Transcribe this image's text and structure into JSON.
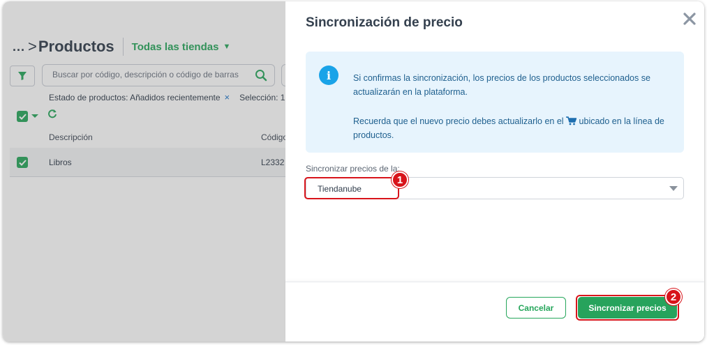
{
  "background": {
    "breadcrumb_dots": "...",
    "breadcrumb_chevron": ">",
    "page_title": "Productos",
    "store_selector": "Todas las tiendas",
    "search_placeholder": "Buscar por código, descripción o código de barras",
    "filter_state": "Estado de productos: Añadidos recientemente",
    "filter_remove": "×",
    "selection_label": "Selección: 1",
    "table": {
      "col_description": "Descripción",
      "col_code": "Código",
      "rows": [
        {
          "description": "Libros",
          "code": "L2332"
        }
      ]
    }
  },
  "modal": {
    "title": "Sincronización de precio",
    "info_icon": "i",
    "info_line1": "Si confirmas la sincronización, los precios de los productos seleccionados se actualizarán en la plataforma.",
    "info_line2_before": "Recuerda que el nuevo precio debes actualizarlo en el ",
    "info_line2_after": " ubicado en la línea de productos.",
    "sync_label": "Sincronizar precios de la:",
    "sync_value": "Tiendanube",
    "cancel_label": "Cancelar",
    "sync_button_label": "Sincronizar precios"
  },
  "annotations": {
    "step1": "1",
    "step2": "2"
  },
  "colors": {
    "accent_green": "#27a35c",
    "info_blue": "#1aa3e8",
    "highlight_red": "#d8141b"
  },
  "icons": [
    "filter-icon",
    "search-icon",
    "checkbox-icon",
    "refresh-icon",
    "close-icon",
    "info-icon",
    "cart-icon",
    "dropdown-arrow-icon"
  ]
}
